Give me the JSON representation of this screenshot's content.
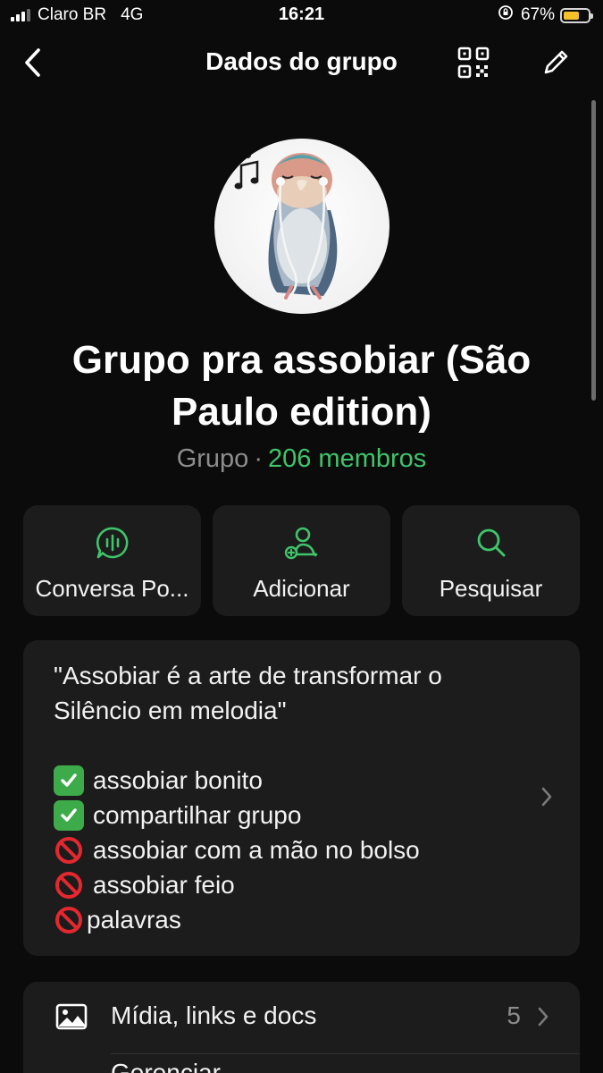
{
  "status_bar": {
    "carrier": "Claro BR",
    "network": "4G",
    "time": "16:21",
    "battery_percent": "67%",
    "battery_level": 0.67,
    "battery_color": "#f5c02a"
  },
  "nav": {
    "title": "Dados do grupo",
    "back_icon": "chevron-left-icon",
    "qr_icon": "qr-code-icon",
    "edit_icon": "pencil-icon"
  },
  "group": {
    "name": "Grupo pra assobiar (São Paulo edition)",
    "type": "Grupo",
    "separator": "·",
    "members": "206 membros",
    "accent_color": "#3fc46a"
  },
  "actions": [
    {
      "label": "Conversa Po...",
      "icon": "voice-chat-icon"
    },
    {
      "label": "Adicionar",
      "icon": "add-person-icon"
    },
    {
      "label": "Pesquisar",
      "icon": "search-icon"
    }
  ],
  "description": {
    "quote_line1": "\"Assobiar é a arte de transformar o",
    "quote_line2": "Silêncio em melodia\"",
    "rules": [
      {
        "icon": "check-mark-icon",
        "text": "assobiar bonito"
      },
      {
        "icon": "check-mark-icon",
        "text": "compartilhar grupo"
      },
      {
        "icon": "prohibited-icon",
        "text": "assobiar com a mão no bolso"
      },
      {
        "icon": "prohibited-icon",
        "text": "assobiar feio"
      },
      {
        "icon": "prohibited-icon",
        "text": "palavras"
      }
    ]
  },
  "media": {
    "label": "Mídia, links e docs",
    "count": "5",
    "icon": "image-icon"
  },
  "next_row": {
    "label": "Gerenciar"
  }
}
